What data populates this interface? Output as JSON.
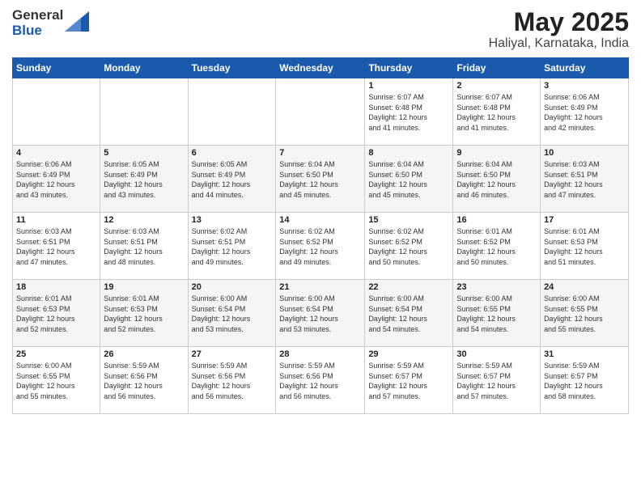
{
  "header": {
    "logo_general": "General",
    "logo_blue": "Blue",
    "month_year": "May 2025",
    "location": "Haliyal, Karnataka, India"
  },
  "weekdays": [
    "Sunday",
    "Monday",
    "Tuesday",
    "Wednesday",
    "Thursday",
    "Friday",
    "Saturday"
  ],
  "weeks": [
    [
      {
        "day": "",
        "info": ""
      },
      {
        "day": "",
        "info": ""
      },
      {
        "day": "",
        "info": ""
      },
      {
        "day": "",
        "info": ""
      },
      {
        "day": "1",
        "info": "Sunrise: 6:07 AM\nSunset: 6:48 PM\nDaylight: 12 hours\nand 41 minutes."
      },
      {
        "day": "2",
        "info": "Sunrise: 6:07 AM\nSunset: 6:48 PM\nDaylight: 12 hours\nand 41 minutes."
      },
      {
        "day": "3",
        "info": "Sunrise: 6:06 AM\nSunset: 6:49 PM\nDaylight: 12 hours\nand 42 minutes."
      }
    ],
    [
      {
        "day": "4",
        "info": "Sunrise: 6:06 AM\nSunset: 6:49 PM\nDaylight: 12 hours\nand 43 minutes."
      },
      {
        "day": "5",
        "info": "Sunrise: 6:05 AM\nSunset: 6:49 PM\nDaylight: 12 hours\nand 43 minutes."
      },
      {
        "day": "6",
        "info": "Sunrise: 6:05 AM\nSunset: 6:49 PM\nDaylight: 12 hours\nand 44 minutes."
      },
      {
        "day": "7",
        "info": "Sunrise: 6:04 AM\nSunset: 6:50 PM\nDaylight: 12 hours\nand 45 minutes."
      },
      {
        "day": "8",
        "info": "Sunrise: 6:04 AM\nSunset: 6:50 PM\nDaylight: 12 hours\nand 45 minutes."
      },
      {
        "day": "9",
        "info": "Sunrise: 6:04 AM\nSunset: 6:50 PM\nDaylight: 12 hours\nand 46 minutes."
      },
      {
        "day": "10",
        "info": "Sunrise: 6:03 AM\nSunset: 6:51 PM\nDaylight: 12 hours\nand 47 minutes."
      }
    ],
    [
      {
        "day": "11",
        "info": "Sunrise: 6:03 AM\nSunset: 6:51 PM\nDaylight: 12 hours\nand 47 minutes."
      },
      {
        "day": "12",
        "info": "Sunrise: 6:03 AM\nSunset: 6:51 PM\nDaylight: 12 hours\nand 48 minutes."
      },
      {
        "day": "13",
        "info": "Sunrise: 6:02 AM\nSunset: 6:51 PM\nDaylight: 12 hours\nand 49 minutes."
      },
      {
        "day": "14",
        "info": "Sunrise: 6:02 AM\nSunset: 6:52 PM\nDaylight: 12 hours\nand 49 minutes."
      },
      {
        "day": "15",
        "info": "Sunrise: 6:02 AM\nSunset: 6:52 PM\nDaylight: 12 hours\nand 50 minutes."
      },
      {
        "day": "16",
        "info": "Sunrise: 6:01 AM\nSunset: 6:52 PM\nDaylight: 12 hours\nand 50 minutes."
      },
      {
        "day": "17",
        "info": "Sunrise: 6:01 AM\nSunset: 6:53 PM\nDaylight: 12 hours\nand 51 minutes."
      }
    ],
    [
      {
        "day": "18",
        "info": "Sunrise: 6:01 AM\nSunset: 6:53 PM\nDaylight: 12 hours\nand 52 minutes."
      },
      {
        "day": "19",
        "info": "Sunrise: 6:01 AM\nSunset: 6:53 PM\nDaylight: 12 hours\nand 52 minutes."
      },
      {
        "day": "20",
        "info": "Sunrise: 6:00 AM\nSunset: 6:54 PM\nDaylight: 12 hours\nand 53 minutes."
      },
      {
        "day": "21",
        "info": "Sunrise: 6:00 AM\nSunset: 6:54 PM\nDaylight: 12 hours\nand 53 minutes."
      },
      {
        "day": "22",
        "info": "Sunrise: 6:00 AM\nSunset: 6:54 PM\nDaylight: 12 hours\nand 54 minutes."
      },
      {
        "day": "23",
        "info": "Sunrise: 6:00 AM\nSunset: 6:55 PM\nDaylight: 12 hours\nand 54 minutes."
      },
      {
        "day": "24",
        "info": "Sunrise: 6:00 AM\nSunset: 6:55 PM\nDaylight: 12 hours\nand 55 minutes."
      }
    ],
    [
      {
        "day": "25",
        "info": "Sunrise: 6:00 AM\nSunset: 6:55 PM\nDaylight: 12 hours\nand 55 minutes."
      },
      {
        "day": "26",
        "info": "Sunrise: 5:59 AM\nSunset: 6:56 PM\nDaylight: 12 hours\nand 56 minutes."
      },
      {
        "day": "27",
        "info": "Sunrise: 5:59 AM\nSunset: 6:56 PM\nDaylight: 12 hours\nand 56 minutes."
      },
      {
        "day": "28",
        "info": "Sunrise: 5:59 AM\nSunset: 6:56 PM\nDaylight: 12 hours\nand 56 minutes."
      },
      {
        "day": "29",
        "info": "Sunrise: 5:59 AM\nSunset: 6:57 PM\nDaylight: 12 hours\nand 57 minutes."
      },
      {
        "day": "30",
        "info": "Sunrise: 5:59 AM\nSunset: 6:57 PM\nDaylight: 12 hours\nand 57 minutes."
      },
      {
        "day": "31",
        "info": "Sunrise: 5:59 AM\nSunset: 6:57 PM\nDaylight: 12 hours\nand 58 minutes."
      }
    ]
  ]
}
